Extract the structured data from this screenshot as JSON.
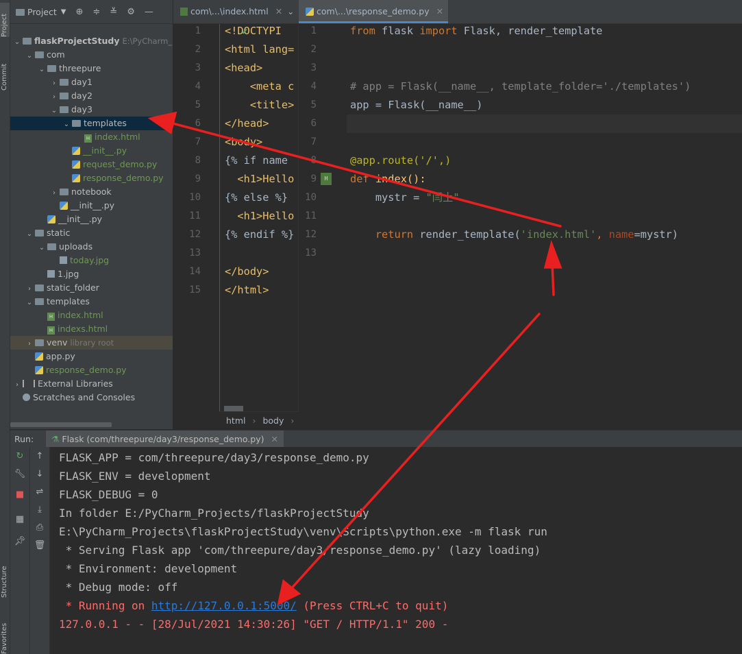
{
  "left_strip": {
    "project": "Project",
    "commit": "Commit",
    "structure": "Structure",
    "favorites": "Favorites"
  },
  "project_panel": {
    "title": "Project",
    "tree": [
      {
        "label": "flaskProjectStudy",
        "extra": "E:\\PyCharm_Pr",
        "kind": "folder",
        "depth": 0,
        "expanded": true
      },
      {
        "label": "com",
        "kind": "folder",
        "depth": 1,
        "expanded": true
      },
      {
        "label": "threepure",
        "kind": "folder",
        "depth": 2,
        "expanded": true
      },
      {
        "label": "day1",
        "kind": "folder",
        "depth": 3,
        "expanded": false
      },
      {
        "label": "day2",
        "kind": "folder",
        "depth": 3,
        "expanded": false
      },
      {
        "label": "day3",
        "kind": "folder",
        "depth": 3,
        "expanded": true
      },
      {
        "label": "templates",
        "kind": "folder",
        "depth": 4,
        "expanded": true,
        "selected": true
      },
      {
        "label": "index.html",
        "kind": "html",
        "depth": 5
      },
      {
        "label": "__init__.py",
        "kind": "py",
        "depth": 4
      },
      {
        "label": "request_demo.py",
        "kind": "py",
        "depth": 4
      },
      {
        "label": "response_demo.py",
        "kind": "py",
        "depth": 4
      },
      {
        "label": "notebook",
        "kind": "folder",
        "depth": 3,
        "expanded": false
      },
      {
        "label": "__init__.py",
        "kind": "py-plain",
        "depth": 3
      },
      {
        "label": "__init__.py",
        "kind": "py-plain",
        "depth": 2
      },
      {
        "label": "static",
        "kind": "folder",
        "depth": 1,
        "expanded": true
      },
      {
        "label": "uploads",
        "kind": "folder",
        "depth": 2,
        "expanded": true
      },
      {
        "label": "today.jpg",
        "kind": "img-green",
        "depth": 3
      },
      {
        "label": "1.jpg",
        "kind": "img",
        "depth": 2
      },
      {
        "label": "static_folder",
        "kind": "folder",
        "depth": 1,
        "expanded": false
      },
      {
        "label": "templates",
        "kind": "folder",
        "depth": 1,
        "expanded": true
      },
      {
        "label": "index.html",
        "kind": "html",
        "depth": 2
      },
      {
        "label": "indexs.html",
        "kind": "html",
        "depth": 2
      },
      {
        "label": "venv",
        "extra": "library root",
        "kind": "folder",
        "depth": 1,
        "expanded": false,
        "venv": true
      },
      {
        "label": "app.py",
        "kind": "py-plain",
        "depth": 1
      },
      {
        "label": "response_demo.py",
        "kind": "py",
        "depth": 1
      },
      {
        "label": "External Libraries",
        "kind": "lib",
        "depth": 0,
        "expanded": false
      },
      {
        "label": "Scratches and Consoles",
        "kind": "scratch",
        "depth": 0
      }
    ]
  },
  "tabs": [
    {
      "label": "com\\...\\index.html"
    },
    {
      "label": "com\\...\\response_demo.py"
    }
  ],
  "html_editor": {
    "lines": [
      {
        "n": "1",
        "code": "<!DOCTYPI"
      },
      {
        "n": "2",
        "code": "<html lang="
      },
      {
        "n": "3",
        "code": "<head>"
      },
      {
        "n": "4",
        "code": "    <meta c"
      },
      {
        "n": "5",
        "code": "    <title>"
      },
      {
        "n": "6",
        "code": "</head>"
      },
      {
        "n": "7",
        "code": "<body>"
      },
      {
        "n": "8",
        "code": "{% if name"
      },
      {
        "n": "9",
        "code": "  <h1>Hello"
      },
      {
        "n": "10",
        "code": "{% else %}"
      },
      {
        "n": "11",
        "code": "  <h1>Hello"
      },
      {
        "n": "12",
        "code": "{% endif %}"
      },
      {
        "n": "13",
        "code": ""
      },
      {
        "n": "14",
        "code": "</body>"
      },
      {
        "n": "15",
        "code": "</html>"
      }
    ],
    "breadcrumb": [
      "html",
      "body"
    ]
  },
  "py_editor": {
    "line_numbers": [
      "1",
      "2",
      "3",
      "4",
      "5",
      "6",
      "7",
      "8",
      "9",
      "10",
      "11",
      "12",
      "13"
    ],
    "l1_from": "from",
    "l1_mod": " flask ",
    "l1_import": "import",
    "l1_rest": " Flask, render_template",
    "l4": "# app = Flask(__name__, template_folder='./templates')",
    "l5": "app = Flask(__name__)",
    "l8": "@app.route('/',)",
    "l9_def": "def",
    "l9_rest": " index():",
    "l10_var": "    mystr = ",
    "l10_str": "\"闫土\"",
    "l12_ret": "    return",
    "l12_fn": " render_template(",
    "l12_str": "'index.html'",
    "l12_sep": ", ",
    "l12_param": "name",
    "l12_end": "=mystr)"
  },
  "run": {
    "label": "Run:",
    "tab": "Flask (com/threepure/day3/response_demo.py)",
    "console": [
      "FLASK_APP = com/threepure/day3/response_demo.py",
      "FLASK_ENV = development",
      "FLASK_DEBUG = 0",
      "In folder E:/PyCharm_Projects/flaskProjectStudy",
      "E:\\PyCharm_Projects\\flaskProjectStudy\\venv\\Scripts\\python.exe -m flask run",
      " * Serving Flask app 'com/threepure/day3/response_demo.py' (lazy loading)",
      " * Environment: development",
      " * Debug mode: off"
    ],
    "running_prefix": " * Running on ",
    "running_url": "http://127.0.0.1:5000/",
    "running_suffix": " (Press CTRL+C to quit)",
    "request_log": "127.0.0.1 - - [28/Jul/2021 14:30:26] \"GET / HTTP/1.1\" 200 -"
  },
  "annotation_color": "#e8201f"
}
